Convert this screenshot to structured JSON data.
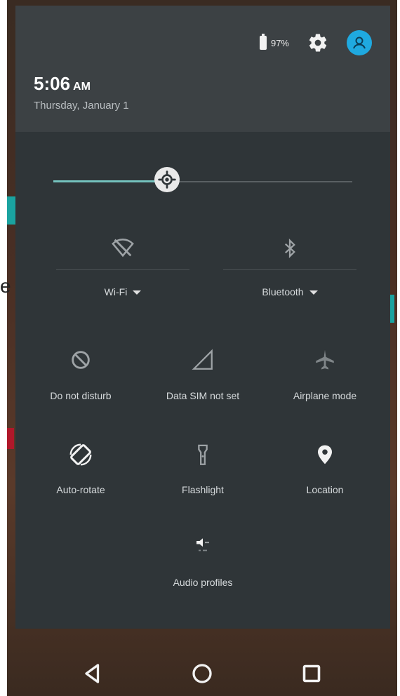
{
  "edge": {
    "char": "e"
  },
  "status": {
    "battery_text": "97%",
    "battery_icon": "battery-icon",
    "settings_icon": "gear-icon",
    "user_icon": "user-avatar-icon",
    "accent": "#1fa9e0"
  },
  "header": {
    "time": "5:06",
    "ampm": "AM",
    "date": "Thursday, January 1"
  },
  "brightness": {
    "level": 0.38,
    "accent": "#74c2bd"
  },
  "wide_tiles": [
    {
      "label": "Wi-Fi",
      "icon": "wifi-off-icon"
    },
    {
      "label": "Bluetooth",
      "icon": "bluetooth-icon"
    }
  ],
  "tiles": [
    {
      "label": "Do not disturb",
      "icon": "dnd-icon"
    },
    {
      "label": "Data SIM not set",
      "icon": "signal-icon"
    },
    {
      "label": "Airplane mode",
      "icon": "airplane-icon"
    },
    {
      "label": "Auto-rotate",
      "icon": "rotate-icon"
    },
    {
      "label": "Flashlight",
      "icon": "flashlight-icon"
    },
    {
      "label": "Location",
      "icon": "location-icon"
    },
    {
      "label": "Audio profiles",
      "icon": "audio-profile-icon"
    }
  ],
  "nav": {
    "back": "back-icon",
    "home": "home-icon",
    "recents": "recents-icon"
  }
}
